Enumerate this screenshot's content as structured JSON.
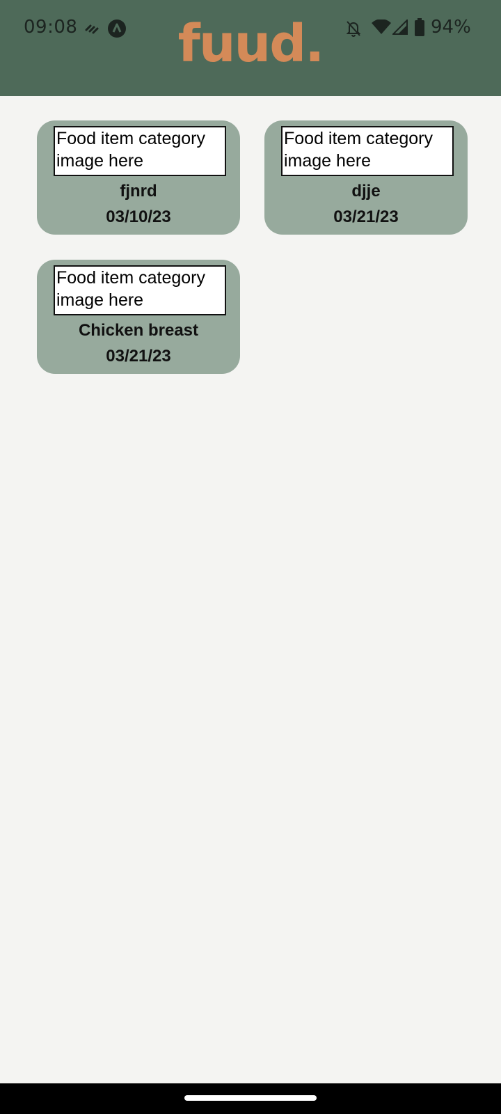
{
  "status_bar": {
    "time": "09:08",
    "battery_percent": "94%",
    "icons": [
      "signal-link-icon",
      "app-notification-icon",
      "notifications-off-icon",
      "wifi-icon",
      "cell-signal-icon",
      "battery-icon"
    ]
  },
  "app": {
    "logo": "fuud."
  },
  "food_items": [
    {
      "image_placeholder": "Food item category image here",
      "name": "fjnrd",
      "date": "03/10/23"
    },
    {
      "image_placeholder": "Food item category image here",
      "name": "djje",
      "date": "03/21/23"
    },
    {
      "image_placeholder": "Food item category image here",
      "name": "Chicken breast",
      "date": "03/21/23"
    }
  ],
  "colors": {
    "header": "#4e6a59",
    "logo": "#d48a58",
    "card": "#97aa9d",
    "background": "#f4f4f2"
  }
}
